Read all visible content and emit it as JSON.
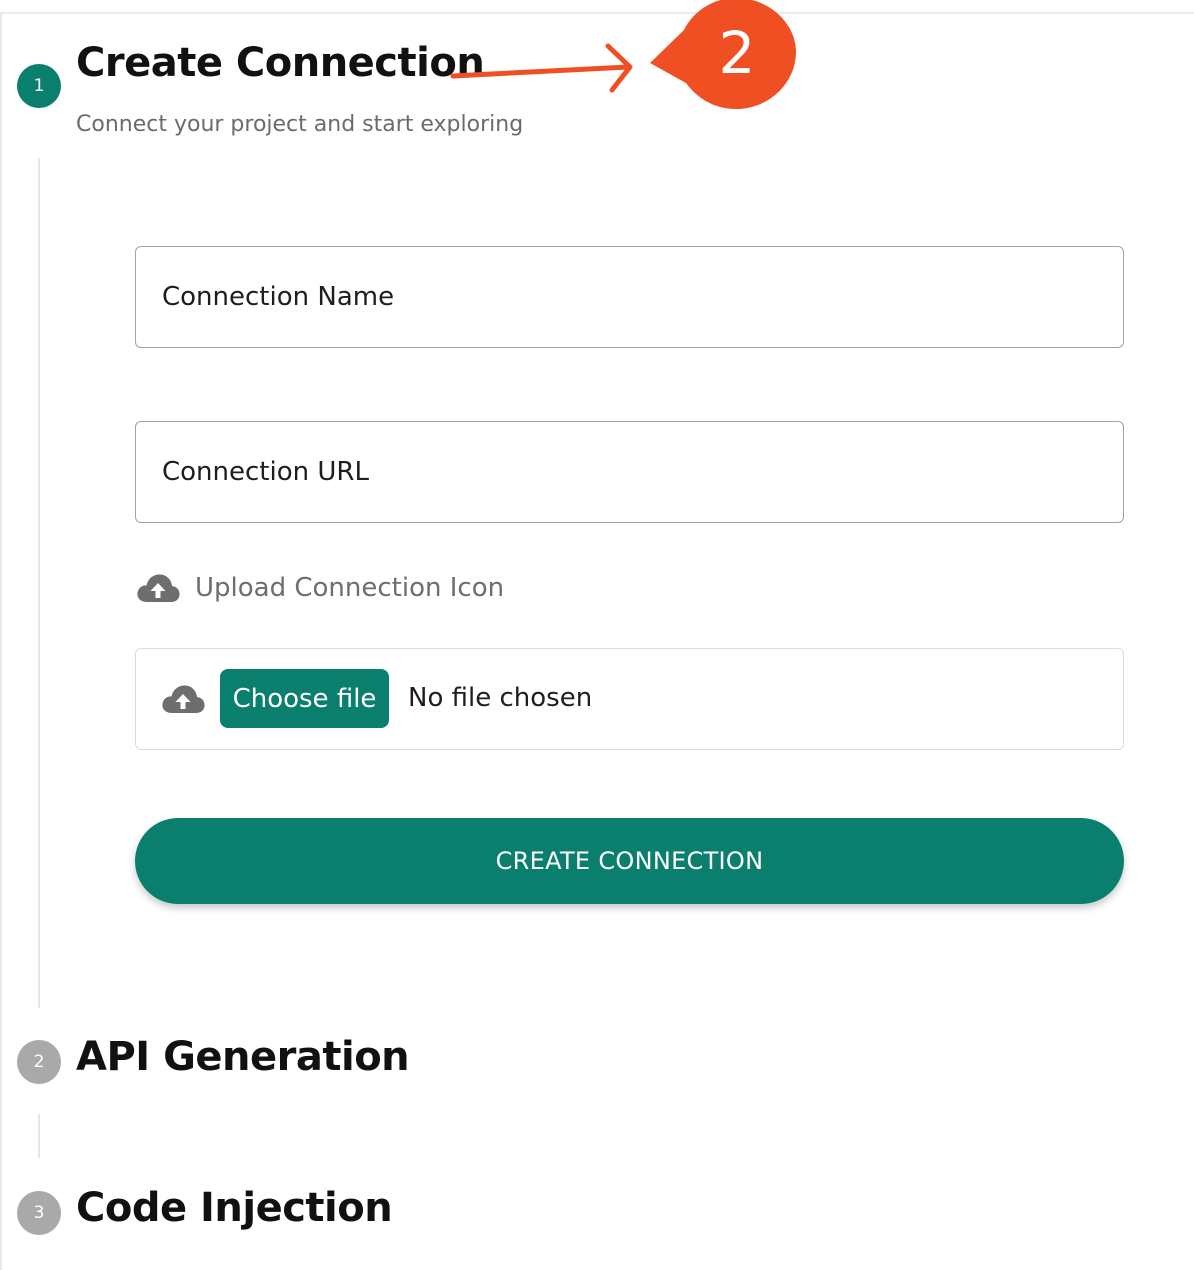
{
  "colors": {
    "accent": "#0a7f6e",
    "inactive_step": "#a9a9a9",
    "annotation": "#f04e23"
  },
  "steps": [
    {
      "number": "1",
      "title": "Create Connection",
      "subtitle": "Connect your project and start exploring",
      "status": "active"
    },
    {
      "number": "2",
      "title": "API Generation",
      "status": "inactive"
    },
    {
      "number": "3",
      "title": "Code Injection",
      "status": "inactive"
    }
  ],
  "form": {
    "connection_name_label": "Connection Name",
    "connection_url_label": "Connection URL",
    "upload_icon_label": "Upload Connection Icon",
    "upload_icon_name": "cloud-upload-icon",
    "choose_file_label": "Choose file",
    "no_file_text": "No file chosen",
    "submit_label": "CREATE CONNECTION"
  },
  "annotation": {
    "badge_number": "2"
  }
}
